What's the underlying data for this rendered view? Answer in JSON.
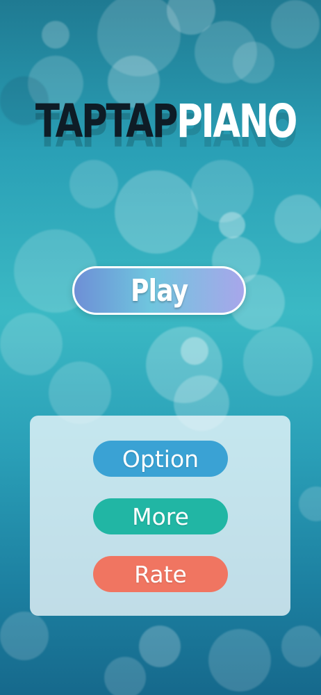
{
  "app": {
    "title_dark": "TAPTAP",
    "title_light": "PIANO"
  },
  "main": {
    "play_label": "Play"
  },
  "menu": {
    "option_label": "Option",
    "more_label": "More",
    "rate_label": "Rate"
  },
  "colors": {
    "option_button": "#3aa2d4",
    "more_button": "#21b6a4",
    "rate_button": "#f07561",
    "title_dark": "#0e1c26"
  }
}
